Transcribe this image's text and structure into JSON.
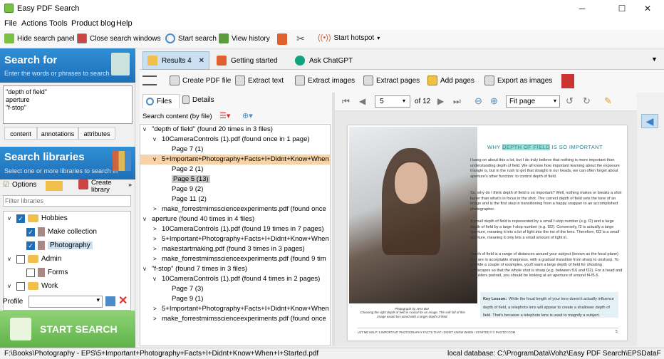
{
  "window": {
    "title": "Easy PDF Search"
  },
  "menu": [
    "File",
    "Actions",
    "Tools",
    "Product blog",
    "Help"
  ],
  "toolbar": {
    "hide_panel": "Hide search panel",
    "close_windows": "Close search windows",
    "start_search": "Start search",
    "view_history": "View history",
    "start_hotspot": "Start hotspot"
  },
  "search_for": {
    "title": "Search for",
    "subtitle": "Enter the words or phrases to search",
    "query": "\"depth of field\"\naperture\n\"f-stop\"",
    "tabs": [
      "content",
      "annotations",
      "attributes"
    ]
  },
  "libraries": {
    "title": "Search libraries",
    "subtitle": "Select one or more libraries to search in",
    "options_label": "Options",
    "create_label": "Create library",
    "filter_placeholder": "Filter libraries",
    "tree": [
      {
        "label": "Hobbies",
        "checked": true,
        "type": "folder",
        "indent": 1
      },
      {
        "label": "Make collection",
        "checked": true,
        "type": "book",
        "indent": 2
      },
      {
        "label": "Photography",
        "checked": true,
        "type": "book",
        "indent": 2
      },
      {
        "label": "Admin",
        "checked": false,
        "type": "folder",
        "indent": 1
      },
      {
        "label": "Forms",
        "checked": false,
        "type": "book",
        "indent": 2
      },
      {
        "label": "Work",
        "checked": false,
        "type": "folder",
        "indent": 1
      }
    ],
    "profile_label": "Profile"
  },
  "start_button": "START SEARCH",
  "doc_tabs": {
    "results": "Results 4",
    "getting_started": "Getting started",
    "chatgpt": "Ask ChatGPT"
  },
  "actions": [
    "Create PDF file",
    "Extract text",
    "Extract images",
    "Extract pages",
    "Add pages",
    "Export as images"
  ],
  "results_panel": {
    "tab_files": "Files",
    "tab_details": "Details",
    "sort_label": "Search content (by file)",
    "rows": [
      {
        "t": "\"depth of field\" (found 20 times in 3 files)",
        "lvl": 0,
        "arrow": "v"
      },
      {
        "t": "10CameraControls (1).pdf (found once in 1 page)",
        "lvl": 1,
        "arrow": "v"
      },
      {
        "t": "Page 7 (1)",
        "lvl": 2,
        "arrow": ""
      },
      {
        "t": "5+Important+Photography+Facts+I+Didnt+Know+When",
        "lvl": 1,
        "arrow": "v",
        "sel": true
      },
      {
        "t": "Page 2 (1)",
        "lvl": 2,
        "arrow": ""
      },
      {
        "t": "Page 5 (13)",
        "lvl": 2,
        "arrow": "",
        "cur": true
      },
      {
        "t": "Page 9 (2)",
        "lvl": 2,
        "arrow": ""
      },
      {
        "t": "Page 11 (2)",
        "lvl": 2,
        "arrow": ""
      },
      {
        "t": "make_forrestmimsscienceexperiments.pdf (found once",
        "lvl": 1,
        "arrow": ">"
      },
      {
        "t": "aperture (found 40 times in 4 files)",
        "lvl": 0,
        "arrow": "v"
      },
      {
        "t": "10CameraControls (1).pdf (found 19 times in 7 pages)",
        "lvl": 1,
        "arrow": ">"
      },
      {
        "t": "5+Important+Photography+Facts+I+Didnt+Know+When",
        "lvl": 1,
        "arrow": ">"
      },
      {
        "t": "makestartmaking.pdf (found 3 times in 3 pages)",
        "lvl": 1,
        "arrow": ">"
      },
      {
        "t": "make_forrestmimsscienceexperiments.pdf (found 9 tim",
        "lvl": 1,
        "arrow": ">"
      },
      {
        "t": "\"f-stop\" (found 7 times in 3 files)",
        "lvl": 0,
        "arrow": "v"
      },
      {
        "t": "10CameraControls (1).pdf (found 4 times in 2 pages)",
        "lvl": 1,
        "arrow": "v"
      },
      {
        "t": "Page 7 (3)",
        "lvl": 2,
        "arrow": ""
      },
      {
        "t": "Page 9 (1)",
        "lvl": 2,
        "arrow": ""
      },
      {
        "t": "5+Important+Photography+Facts+I+Didnt+Know+When",
        "lvl": 1,
        "arrow": ">"
      },
      {
        "t": "make_forrestmimsscienceexperiments.pdf (found once",
        "lvl": 1,
        "arrow": ">"
      }
    ]
  },
  "viewer": {
    "page_num": "5",
    "page_total": "of 12",
    "zoom": "Fit page",
    "doc_heading_pre": "WHY ",
    "doc_heading_hl": "DEPTH OF FIELD",
    "doc_heading_post": " IS SO IMPORTANT",
    "photo_credit": "Photograph by Jess Bot",
    "photo_caption": "Choosing the right depth of field is crucial for an image. The soft fall of this image would be ruined with a larger depth of field.",
    "para1": "I bang on about this a lot, but I do truly believe that nothing is more important than understanding depth of field. We all know how important learning about the exposure triangle is, but in the rush to get that straight in our heads, we can often forget about aperture's other function: to control depth of field.",
    "para2": "So, why do I think depth of field is so important? Well, nothing makes or breaks a shot faster than what's in focus in the shot. The correct depth of field sets the tone of an image and is the first step in transitioning from a happy snapper to an accomplished photographer.",
    "para3": "A small depth of field is represented by a small f-stop number (e.g. f2) and a large depth of field by a large f-stop number (e.g. f22). Conversely, f2 is actually a large aperture, meaning it lets a lot of light into the ins of the lens. Therefore, f22 is a small aperture, meaning it only lets a small amount of light in.",
    "para4": "Depth of field is a range of distances around your subject (known as the focal plane) that are in acceptable sharpness, with a gradual transition from sharp to unsharp. To provide a couple of examples, you'll want a large depth of field for shooting landscapes so that the whole shot is sharp (e.g. between f16 and f22). For a head and shoulders portrait, you should be looking at an aperture of around f4-f5.6.",
    "key_title": "Key Lesson:",
    "key_text": "While the focal length of your lens doesn't actually influence depth of field, a telephoto lens will appear to create a shallower depth of field. That's because a telephoto lens is used to magnify a subject.",
    "footer_left": "LET ME HELP: 5 IMPORTANT PHOTOGRAPHY FACTS THAT I DIDN'T KNOW WHEN I STARTED // © PHOTZY.COM",
    "footer_page": "5"
  },
  "status": {
    "path": "F:\\Books\\Photography - EPS\\5+Important+Photography+Facts+I+Didnt+Know+When+I+Started.pdf",
    "db": "local database: C:\\ProgramData\\Vohz\\Easy PDF Search\\EPSDataFile.dt"
  }
}
